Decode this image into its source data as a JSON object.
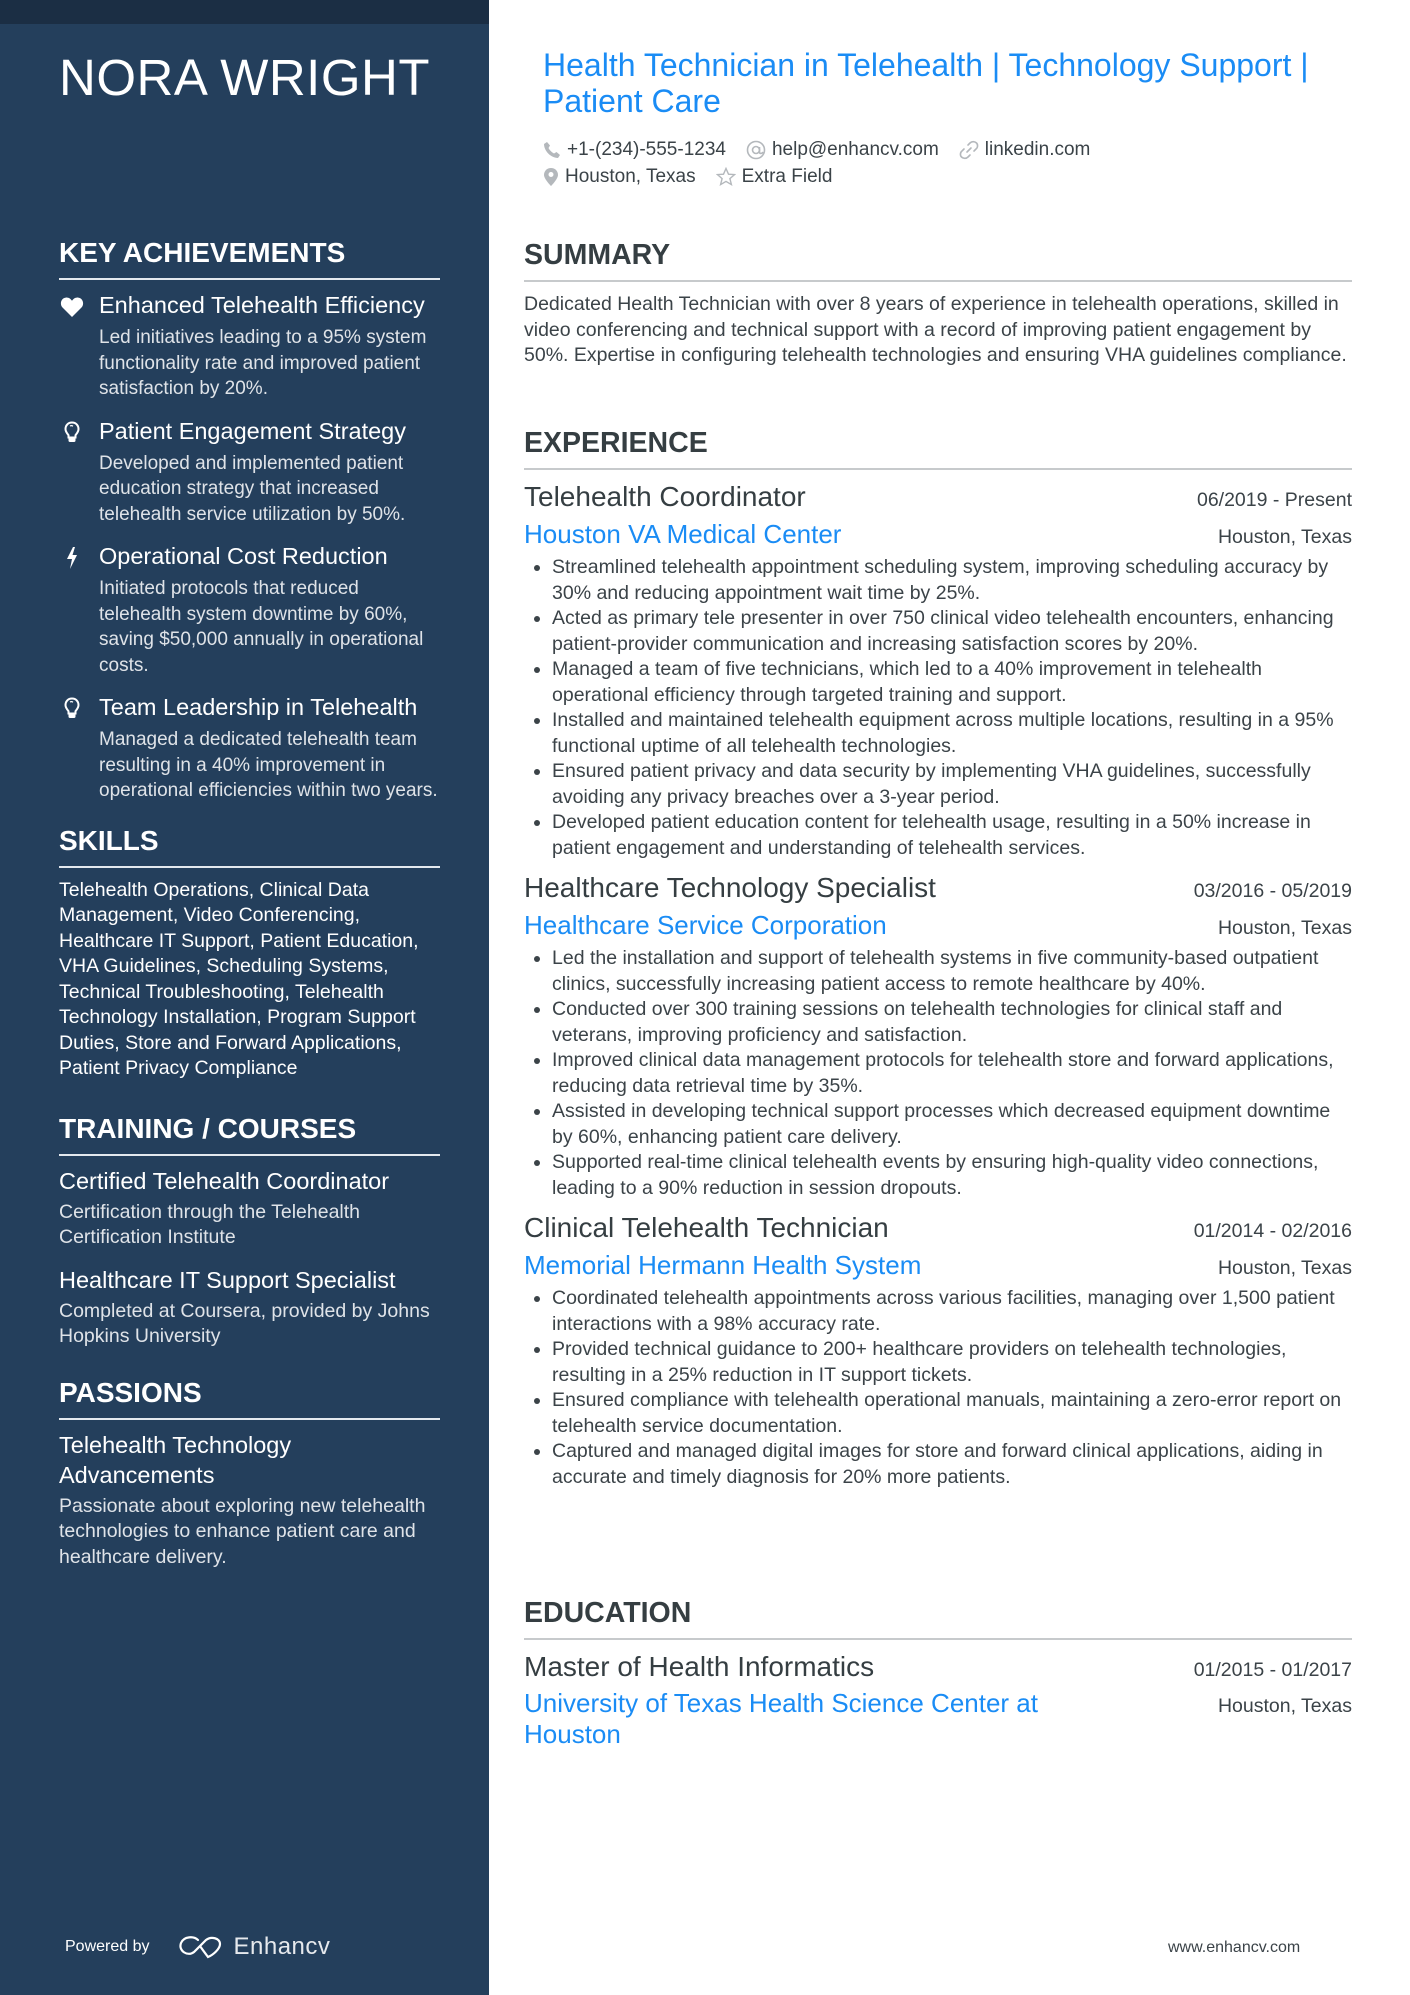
{
  "profile": {
    "name": "NORA WRIGHT",
    "headline": "Health Technician in Telehealth | Technology Support | Patient Care",
    "contacts": {
      "phone": "+1-(234)-555-1234",
      "email": "help@enhancv.com",
      "website": "linkedin.com",
      "location": "Houston, Texas",
      "extra": "Extra Field"
    }
  },
  "sidebar": {
    "achievements": {
      "heading": "KEY ACHIEVEMENTS",
      "items": [
        {
          "icon": "heart-icon",
          "title": "Enhanced Telehealth Efficiency",
          "description": "Led initiatives leading to a 95% system functionality rate and improved patient satisfaction by 20%."
        },
        {
          "icon": "lightbulb-icon",
          "title": "Patient Engagement Strategy",
          "description": "Developed and implemented patient education strategy that increased telehealth service utilization by 50%."
        },
        {
          "icon": "lightning-icon",
          "title": "Operational Cost Reduction",
          "description": "Initiated protocols that reduced telehealth system downtime by 60%, saving $50,000 annually in operational costs."
        },
        {
          "icon": "lightbulb-icon",
          "title": "Team Leadership in Telehealth",
          "description": "Managed a dedicated telehealth team resulting in a 40% improvement in operational efficiencies within two years."
        }
      ]
    },
    "skills": {
      "heading": "SKILLS",
      "text": "Telehealth Operations, Clinical Data Management, Video Conferencing, Healthcare IT Support, Patient Education, VHA Guidelines, Scheduling Systems, Technical Troubleshooting, Telehealth Technology Installation, Program Support Duties, Store and Forward Applications, Patient Privacy Compliance"
    },
    "training": {
      "heading": "TRAINING / COURSES",
      "items": [
        {
          "title": "Certified Telehealth Coordinator",
          "description": "Certification through the Telehealth Certification Institute"
        },
        {
          "title": "Healthcare IT Support Specialist",
          "description": "Completed at Coursera, provided by Johns Hopkins University"
        }
      ]
    },
    "passions": {
      "heading": "PASSIONS",
      "items": [
        {
          "title": "Telehealth Technology Advancements",
          "description": "Passionate about exploring new telehealth technologies to enhance patient care and healthcare delivery."
        }
      ]
    },
    "footer": {
      "powered_by": "Powered by",
      "brand": "Enhancv"
    }
  },
  "main": {
    "summary": {
      "heading": "SUMMARY",
      "text": "Dedicated Health Technician with over 8 years of experience in telehealth operations, skilled in video conferencing and technical support with a record of improving patient engagement by 50%. Expertise in configuring telehealth technologies and ensuring VHA guidelines compliance."
    },
    "experience": {
      "heading": "EXPERIENCE",
      "jobs": [
        {
          "title": "Telehealth Coordinator",
          "dates": "06/2019 - Present",
          "company": "Houston VA Medical Center",
          "location": "Houston, Texas",
          "bullets": [
            "Streamlined telehealth appointment scheduling system, improving scheduling accuracy by 30% and reducing appointment wait time by 25%.",
            "Acted as primary tele presenter in over 750 clinical video telehealth encounters, enhancing patient-provider communication and increasing satisfaction scores by 20%.",
            "Managed a team of five technicians, which led to a 40% improvement in telehealth operational efficiency through targeted training and support.",
            "Installed and maintained telehealth equipment across multiple locations, resulting in a 95% functional uptime of all telehealth technologies.",
            "Ensured patient privacy and data security by implementing VHA guidelines, successfully avoiding any privacy breaches over a 3-year period.",
            "Developed patient education content for telehealth usage, resulting in a 50% increase in patient engagement and understanding of telehealth services."
          ]
        },
        {
          "title": "Healthcare Technology Specialist",
          "dates": "03/2016 - 05/2019",
          "company": "Healthcare Service Corporation",
          "location": "Houston, Texas",
          "bullets": [
            "Led the installation and support of telehealth systems in five community-based outpatient clinics, successfully increasing patient access to remote healthcare by 40%.",
            "Conducted over 300 training sessions on telehealth technologies for clinical staff and veterans, improving proficiency and satisfaction.",
            "Improved clinical data management protocols for telehealth store and forward applications, reducing data retrieval time by 35%.",
            "Assisted in developing technical support processes which decreased equipment downtime by 60%, enhancing patient care delivery.",
            "Supported real-time clinical telehealth events by ensuring high-quality video connections, leading to a 90% reduction in session dropouts."
          ]
        },
        {
          "title": "Clinical Telehealth Technician",
          "dates": "01/2014 - 02/2016",
          "company": "Memorial Hermann Health System",
          "location": "Houston, Texas",
          "bullets": [
            "Coordinated telehealth appointments across various facilities, managing over 1,500 patient interactions with a 98% accuracy rate.",
            "Provided technical guidance to 200+ healthcare providers on telehealth technologies, resulting in a 25% reduction in IT support tickets.",
            "Ensured compliance with telehealth operational manuals, maintaining a zero-error report on telehealth service documentation.",
            "Captured and managed digital images for store and forward clinical applications, aiding in accurate and timely diagnosis for 20% more patients."
          ]
        }
      ]
    },
    "education": {
      "heading": "EDUCATION",
      "items": [
        {
          "degree": "Master of Health Informatics",
          "dates": "01/2015 - 01/2017",
          "school": "University of Texas Health Science Center at Houston",
          "location": "Houston, Texas"
        }
      ]
    },
    "footer": {
      "website": "www.enhancv.com"
    }
  },
  "colors": {
    "sidebar_bg": "#243f5c",
    "sidebar_band": "#1b2e44",
    "accent": "#1a8cf5",
    "text": "#3b4348"
  }
}
